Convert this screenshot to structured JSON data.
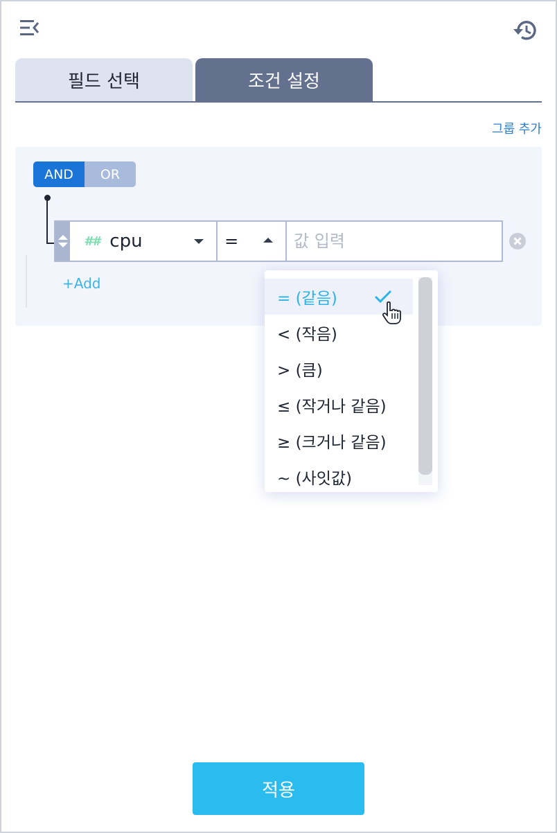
{
  "tabs": [
    {
      "label": "필드 선택",
      "active": false
    },
    {
      "label": "조건 설정",
      "active": true
    }
  ],
  "add_group_label": "그룹 추가",
  "logic": {
    "and_label": "AND",
    "or_label": "OR",
    "selected": "AND"
  },
  "condition": {
    "field_hash": "##",
    "field_name": "cpu",
    "operator": "=",
    "value_placeholder": "값 입력"
  },
  "add_condition_label": "+Add",
  "operator_options": [
    {
      "label": "= (같음)",
      "selected": true
    },
    {
      "label": "< (작음)",
      "selected": false
    },
    {
      "label": "> (큼)",
      "selected": false
    },
    {
      "label": "≤ (작거나 같음)",
      "selected": false
    },
    {
      "label": "≥ (크거나 같음)",
      "selected": false
    },
    {
      "label": "~ (사잇값)",
      "selected": false
    }
  ],
  "apply_label": "적용",
  "colors": {
    "primary": "#1b74d8",
    "accent": "#2bbcef",
    "tab_active": "#64718e",
    "tab_inactive": "#dde3f0"
  }
}
